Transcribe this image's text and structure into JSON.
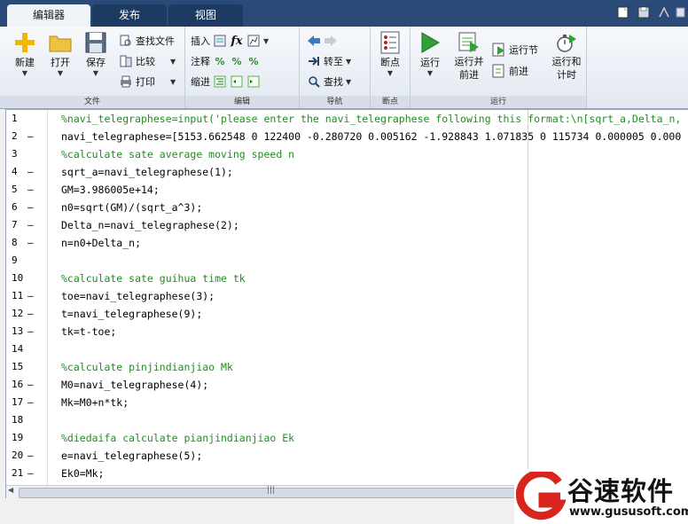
{
  "tabs": [
    {
      "label": "编辑器",
      "active": true
    },
    {
      "label": "发布",
      "active": false
    },
    {
      "label": "视图",
      "active": false
    }
  ],
  "ribbon": {
    "file": {
      "label": "文件",
      "new": "新建",
      "open": "打开",
      "save": "保存",
      "find_files": "查找文件",
      "compare": "比较",
      "print": "打印"
    },
    "edit": {
      "label": "编辑",
      "insert": "插入",
      "comment": "注释",
      "indent": "缩进"
    },
    "nav": {
      "label": "导航",
      "goto": "转至",
      "find": "查找"
    },
    "breakpoints": {
      "label": "断点",
      "breakpoint": "断点"
    },
    "run": {
      "label": "运行",
      "run": "运行",
      "run_advance": "运行并\n前进",
      "run_section": "运行节",
      "advance": "前进",
      "run_time": "运行和\n计时"
    }
  },
  "editor": {
    "lines": [
      {
        "n": "1",
        "dash": "",
        "text": "%navi_telegraphese=input('please enter the navi_telegraphese following this format:\\n[sqrt_a,Delta_n,",
        "kind": "mixed"
      },
      {
        "n": "2",
        "dash": "—",
        "text": "navi_telegraphese=[5153.662548 0 122400 -0.280720 0.005162 -1.928843 1.071835 0 115734 0.000005 0.000",
        "kind": "code"
      },
      {
        "n": "3",
        "dash": "",
        "text": "%calculate sate average moving speed n",
        "kind": "comment"
      },
      {
        "n": "4",
        "dash": "—",
        "text": "sqrt_a=navi_telegraphese(1);",
        "kind": "code"
      },
      {
        "n": "5",
        "dash": "—",
        "text": "GM=3.986005e+14;",
        "kind": "code"
      },
      {
        "n": "6",
        "dash": "—",
        "text": "n0=sqrt(GM)/(sqrt_a^3);",
        "kind": "code"
      },
      {
        "n": "7",
        "dash": "—",
        "text": "Delta_n=navi_telegraphese(2);",
        "kind": "code"
      },
      {
        "n": "8",
        "dash": "—",
        "text": "n=n0+Delta_n;",
        "kind": "code"
      },
      {
        "n": "9",
        "dash": "",
        "text": "",
        "kind": "code"
      },
      {
        "n": "10",
        "dash": "",
        "text": "%calculate sate guihua time tk",
        "kind": "comment"
      },
      {
        "n": "11",
        "dash": "—",
        "text": "toe=navi_telegraphese(3);",
        "kind": "code"
      },
      {
        "n": "12",
        "dash": "—",
        "text": "t=navi_telegraphese(9);",
        "kind": "code"
      },
      {
        "n": "13",
        "dash": "—",
        "text": "tk=t-toe;",
        "kind": "code"
      },
      {
        "n": "14",
        "dash": "",
        "text": "",
        "kind": "code"
      },
      {
        "n": "15",
        "dash": "",
        "text": "%calculate pinjindianjiao Mk",
        "kind": "comment"
      },
      {
        "n": "16",
        "dash": "—",
        "text": "M0=navi_telegraphese(4);",
        "kind": "code"
      },
      {
        "n": "17",
        "dash": "—",
        "text": "Mk=M0+n*tk;",
        "kind": "code"
      },
      {
        "n": "18",
        "dash": "",
        "text": "",
        "kind": "code"
      },
      {
        "n": "19",
        "dash": "",
        "text": "%diedaifa calculate pianjindianjiao Ek",
        "kind": "comment"
      },
      {
        "n": "20",
        "dash": "—",
        "text": "e=navi_telegraphese(5);",
        "kind": "code"
      },
      {
        "n": "21",
        "dash": "—",
        "text": "Ek0=Mk;",
        "kind": "code"
      }
    ]
  },
  "watermark": {
    "name": "谷速软件",
    "url": "www.gususoft.com"
  },
  "colors": {
    "tab_bar": "#2a4a78",
    "comment": "#228b22",
    "string": "#a020f0",
    "logo_red": "#d8261c"
  }
}
